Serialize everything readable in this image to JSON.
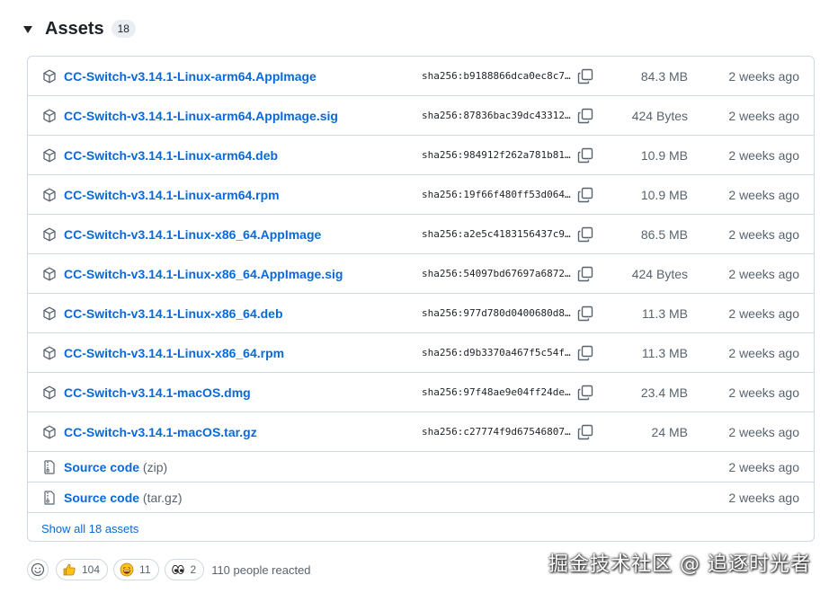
{
  "header": {
    "title": "Assets",
    "count": "18"
  },
  "assets": [
    {
      "name": "CC-Switch-v3.14.1-Linux-arm64.AppImage",
      "sha": "sha256:b9188866dca0ec8c7…",
      "size": "84.3 MB",
      "time": "2 weeks ago"
    },
    {
      "name": "CC-Switch-v3.14.1-Linux-arm64.AppImage.sig",
      "sha": "sha256:87836bac39dc43312…",
      "size": "424 Bytes",
      "time": "2 weeks ago"
    },
    {
      "name": "CC-Switch-v3.14.1-Linux-arm64.deb",
      "sha": "sha256:984912f262a781b81…",
      "size": "10.9 MB",
      "time": "2 weeks ago"
    },
    {
      "name": "CC-Switch-v3.14.1-Linux-arm64.rpm",
      "sha": "sha256:19f66f480ff53d064…",
      "size": "10.9 MB",
      "time": "2 weeks ago"
    },
    {
      "name": "CC-Switch-v3.14.1-Linux-x86_64.AppImage",
      "sha": "sha256:a2e5c4183156437c9…",
      "size": "86.5 MB",
      "time": "2 weeks ago"
    },
    {
      "name": "CC-Switch-v3.14.1-Linux-x86_64.AppImage.sig",
      "sha": "sha256:54097bd67697a6872…",
      "size": "424 Bytes",
      "time": "2 weeks ago"
    },
    {
      "name": "CC-Switch-v3.14.1-Linux-x86_64.deb",
      "sha": "sha256:977d780d0400680d8…",
      "size": "11.3 MB",
      "time": "2 weeks ago"
    },
    {
      "name": "CC-Switch-v3.14.1-Linux-x86_64.rpm",
      "sha": "sha256:d9b3370a467f5c54f…",
      "size": "11.3 MB",
      "time": "2 weeks ago"
    },
    {
      "name": "CC-Switch-v3.14.1-macOS.dmg",
      "sha": "sha256:97f48ae9e04ff24de…",
      "size": "23.4 MB",
      "time": "2 weeks ago"
    },
    {
      "name": "CC-Switch-v3.14.1-macOS.tar.gz",
      "sha": "sha256:c27774f9d67546807…",
      "size": "24 MB",
      "time": "2 weeks ago"
    }
  ],
  "source": [
    {
      "label": "Source code",
      "ext": "(zip)",
      "time": "2 weeks ago"
    },
    {
      "label": "Source code",
      "ext": "(tar.gz)",
      "time": "2 weeks ago"
    }
  ],
  "show_all": "Show all 18 assets",
  "reactions": {
    "items": [
      {
        "icon": "thumbs-up-icon",
        "count": "104"
      },
      {
        "icon": "laugh-icon",
        "count": "11"
      },
      {
        "icon": "eyes-icon",
        "count": "2"
      }
    ],
    "summary": "110 people reacted"
  },
  "watermark": "掘金技术社区 @ 追逐时光者",
  "colors": {
    "link": "#0969da",
    "muted": "#59636e",
    "border": "#d0d7de"
  }
}
